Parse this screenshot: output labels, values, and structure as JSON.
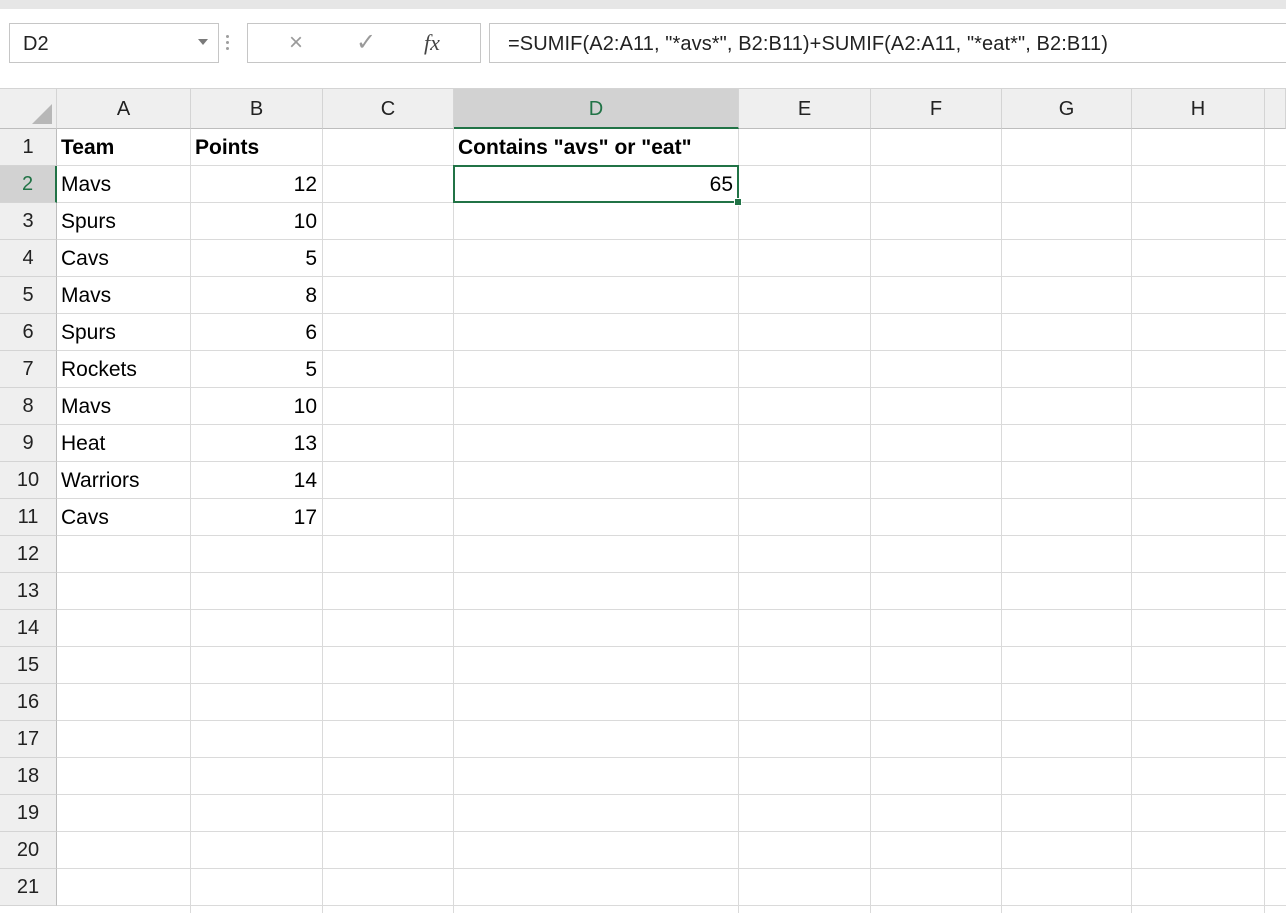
{
  "formula_bar": {
    "name_box": "D2",
    "cancel_glyph": "×",
    "enter_glyph": "✓",
    "fx_label": "fx",
    "formula": "=SUMIF(A2:A11, \"*avs*\", B2:B11)+SUMIF(A2:A11, \"*eat*\", B2:B11)"
  },
  "columns": [
    "A",
    "B",
    "C",
    "D",
    "E",
    "F",
    "G",
    "H"
  ],
  "rows": [
    "1",
    "2",
    "3",
    "4",
    "5",
    "6",
    "7",
    "8",
    "9",
    "10",
    "11",
    "12",
    "13",
    "14",
    "15",
    "16",
    "17",
    "18",
    "19",
    "20",
    "21"
  ],
  "selection": {
    "column": "D",
    "row": "2"
  },
  "sheet": {
    "headers": {
      "team": "Team",
      "points": "Points",
      "result_label": "Contains \"avs\" or \"eat\""
    },
    "data": [
      {
        "team": "Mavs",
        "points": "12"
      },
      {
        "team": "Spurs",
        "points": "10"
      },
      {
        "team": "Cavs",
        "points": "5"
      },
      {
        "team": "Mavs",
        "points": "8"
      },
      {
        "team": "Spurs",
        "points": "6"
      },
      {
        "team": "Rockets",
        "points": "5"
      },
      {
        "team": "Mavs",
        "points": "10"
      },
      {
        "team": "Heat",
        "points": "13"
      },
      {
        "team": "Warriors",
        "points": "14"
      },
      {
        "team": "Cavs",
        "points": "17"
      }
    ],
    "result_value": "65"
  },
  "colors": {
    "accent": "#217346",
    "header_bg": "#efefef",
    "gridline": "#dadada"
  }
}
